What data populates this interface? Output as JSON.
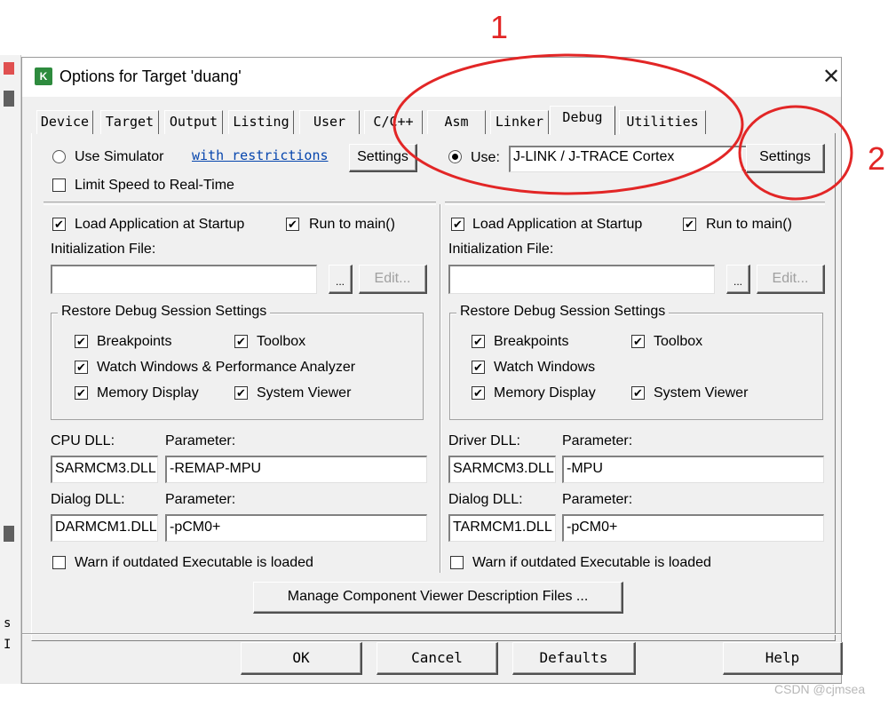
{
  "window": {
    "title": "Options for Target 'duang'",
    "close_glyph": "✕",
    "icon_text": "K"
  },
  "tabs": [
    {
      "label": "Device",
      "active": false
    },
    {
      "label": "Target",
      "active": false
    },
    {
      "label": "Output",
      "active": false
    },
    {
      "label": "Listing",
      "active": false
    },
    {
      "label": "User",
      "active": false
    },
    {
      "label": "C/C++",
      "active": false
    },
    {
      "label": "Asm",
      "active": false
    },
    {
      "label": "Linker",
      "active": false
    },
    {
      "label": "Debug",
      "active": true
    },
    {
      "label": "Utilities",
      "active": false
    }
  ],
  "left": {
    "use_simulator_label": "Use Simulator",
    "use_simulator_selected": false,
    "restrictions_link": "with restrictions",
    "settings_label": "Settings",
    "limit_speed_label": "Limit Speed to Real-Time",
    "limit_speed_checked": false,
    "load_app_label": "Load Application at Startup",
    "load_app_checked": true,
    "run_to_main_label": "Run to main()",
    "run_to_main_checked": true,
    "init_file_label": "Initialization File:",
    "init_file_value": "",
    "browse_label": "...",
    "edit_label": "Edit...",
    "restore_title": "Restore Debug Session Settings",
    "breakpoints_label": "Breakpoints",
    "toolbox_label": "Toolbox",
    "watch_label": "Watch Windows & Performance Analyzer",
    "memory_label": "Memory Display",
    "sysviewer_label": "System Viewer",
    "cpu_dll_label": "CPU DLL:",
    "cpu_param_label": "Parameter:",
    "cpu_dll_value": "SARMCM3.DLL",
    "cpu_param_value": "-REMAP-MPU",
    "dialog_dll_label": "Dialog DLL:",
    "dialog_param_label": "Parameter:",
    "dialog_dll_value": "DARMCM1.DLL",
    "dialog_param_value": "-pCM0+",
    "warn_label": "Warn if outdated Executable is loaded",
    "warn_checked": false
  },
  "right": {
    "use_label": "Use:",
    "use_selected": true,
    "driver_value": "J-LINK / J-TRACE Cortex",
    "settings_label": "Settings",
    "load_app_label": "Load Application at Startup",
    "load_app_checked": true,
    "run_to_main_label": "Run to main()",
    "run_to_main_checked": true,
    "init_file_label": "Initialization File:",
    "init_file_value": "",
    "browse_label": "...",
    "edit_label": "Edit...",
    "restore_title": "Restore Debug Session Settings",
    "breakpoints_label": "Breakpoints",
    "toolbox_label": "Toolbox",
    "watch_label": "Watch Windows",
    "memory_label": "Memory Display",
    "sysviewer_label": "System Viewer",
    "driver_dll_label": "Driver DLL:",
    "driver_param_label": "Parameter:",
    "driver_dll_value": "SARMCM3.DLL",
    "driver_param_value": "-MPU",
    "dialog_dll_label": "Dialog DLL:",
    "dialog_param_label": "Parameter:",
    "dialog_dll_value": "TARMCM1.DLL",
    "dialog_param_value": "-pCM0+",
    "warn_label": "Warn if outdated Executable is loaded",
    "warn_checked": false
  },
  "manage_button": "Manage Component Viewer Description Files ...",
  "footer": {
    "ok": "OK",
    "cancel": "Cancel",
    "defaults": "Defaults",
    "help": "Help"
  },
  "annotations": {
    "one": "1",
    "two": "2",
    "color": "#e22626"
  },
  "background": {
    "letters": [
      "s",
      "I"
    ]
  },
  "watermark": "CSDN @cjmsea"
}
